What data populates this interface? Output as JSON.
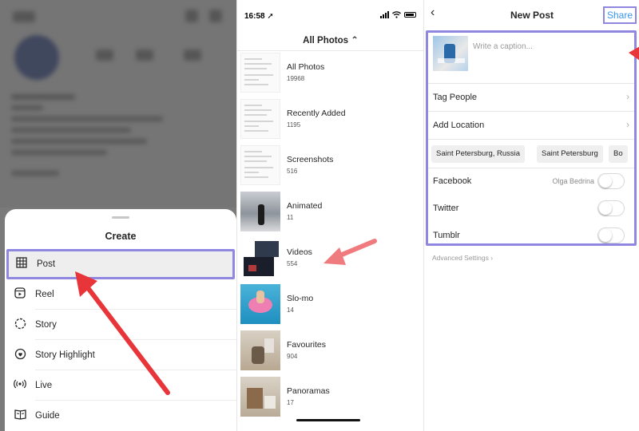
{
  "colors": {
    "highlight": "#8f87e0",
    "arrow": "#e8353a",
    "link": "#3897f0"
  },
  "create_menu": {
    "title": "Create",
    "items": [
      {
        "label": "Post",
        "icon": "grid-icon"
      },
      {
        "label": "Reel",
        "icon": "reel-icon"
      },
      {
        "label": "Story",
        "icon": "story-icon"
      },
      {
        "label": "Story Highlight",
        "icon": "highlight-icon"
      },
      {
        "label": "Live",
        "icon": "live-icon"
      },
      {
        "label": "Guide",
        "icon": "guide-icon"
      }
    ]
  },
  "photos": {
    "status_time": "16:58 ➚",
    "header": "All Photos ⌃",
    "albums": [
      {
        "title": "All Photos",
        "count": "19968"
      },
      {
        "title": "Recently Added",
        "count": "1195"
      },
      {
        "title": "Screenshots",
        "count": "516"
      },
      {
        "title": "Animated",
        "count": "11"
      },
      {
        "title": "Videos",
        "count": "554"
      },
      {
        "title": "Slo-mo",
        "count": "14"
      },
      {
        "title": "Favourites",
        "count": "904"
      },
      {
        "title": "Panoramas",
        "count": "17"
      }
    ]
  },
  "new_post": {
    "back": "‹",
    "title": "New Post",
    "share": "Share",
    "caption_placeholder": "Write a caption...",
    "tag_people": "Tag People",
    "add_location": "Add Location",
    "location_chips": [
      "Saint Petersburg, Russia",
      "Saint Petersburg",
      "Bo"
    ],
    "facebook": "Facebook",
    "facebook_account": "Olga Bedrina",
    "twitter": "Twitter",
    "tumblr": "Tumblr",
    "advanced": "Advanced Settings ›"
  }
}
